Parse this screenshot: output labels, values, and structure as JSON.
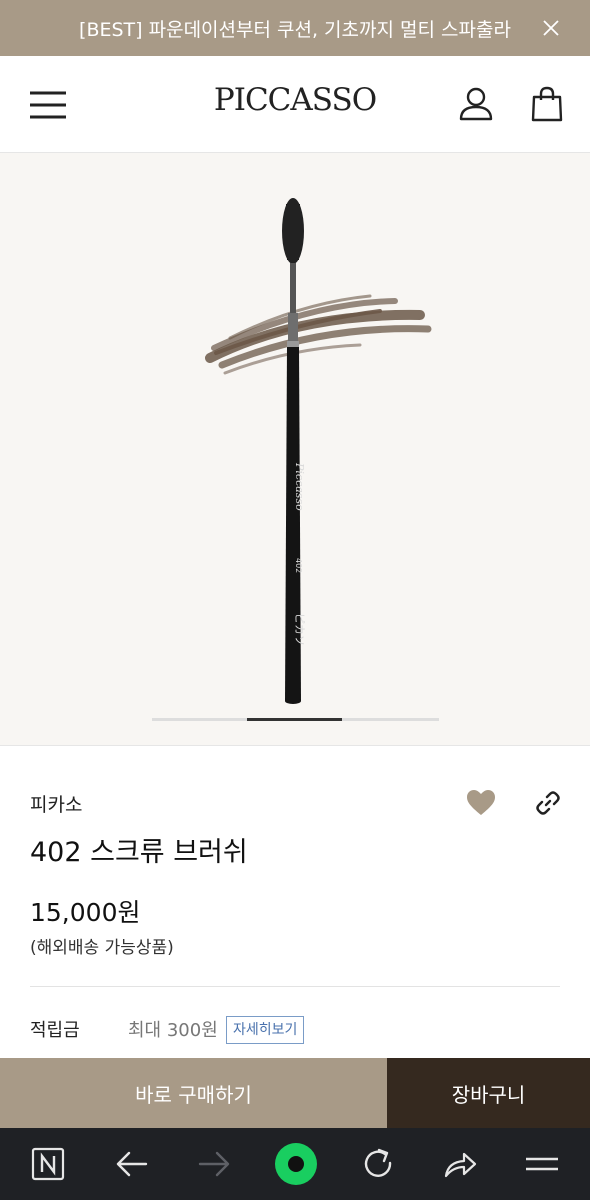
{
  "promo": {
    "text": "[BEST] 파운데이션부터 쿠션, 기초까지 멀티 스파출라"
  },
  "header": {
    "logo": "PICCASSO"
  },
  "hero": {
    "slide_progress": 0.33
  },
  "product": {
    "brand": "피카소",
    "name": "402 스크류 브러쉬",
    "price": "15,000원",
    "shipping_note": "(해외배송 가능상품)",
    "points_label": "적립금",
    "points_value": "최대 300원",
    "points_detail_button": "자세히보기"
  },
  "actions": {
    "buy_now": "바로 구매하기",
    "cart": "장바구니"
  },
  "colors": {
    "promo_bg": "#a89a87",
    "buy_bg": "#a89a87",
    "cart_bg": "#35291f",
    "browser_bg": "#1f2125",
    "accent_green": "#19ce60"
  }
}
